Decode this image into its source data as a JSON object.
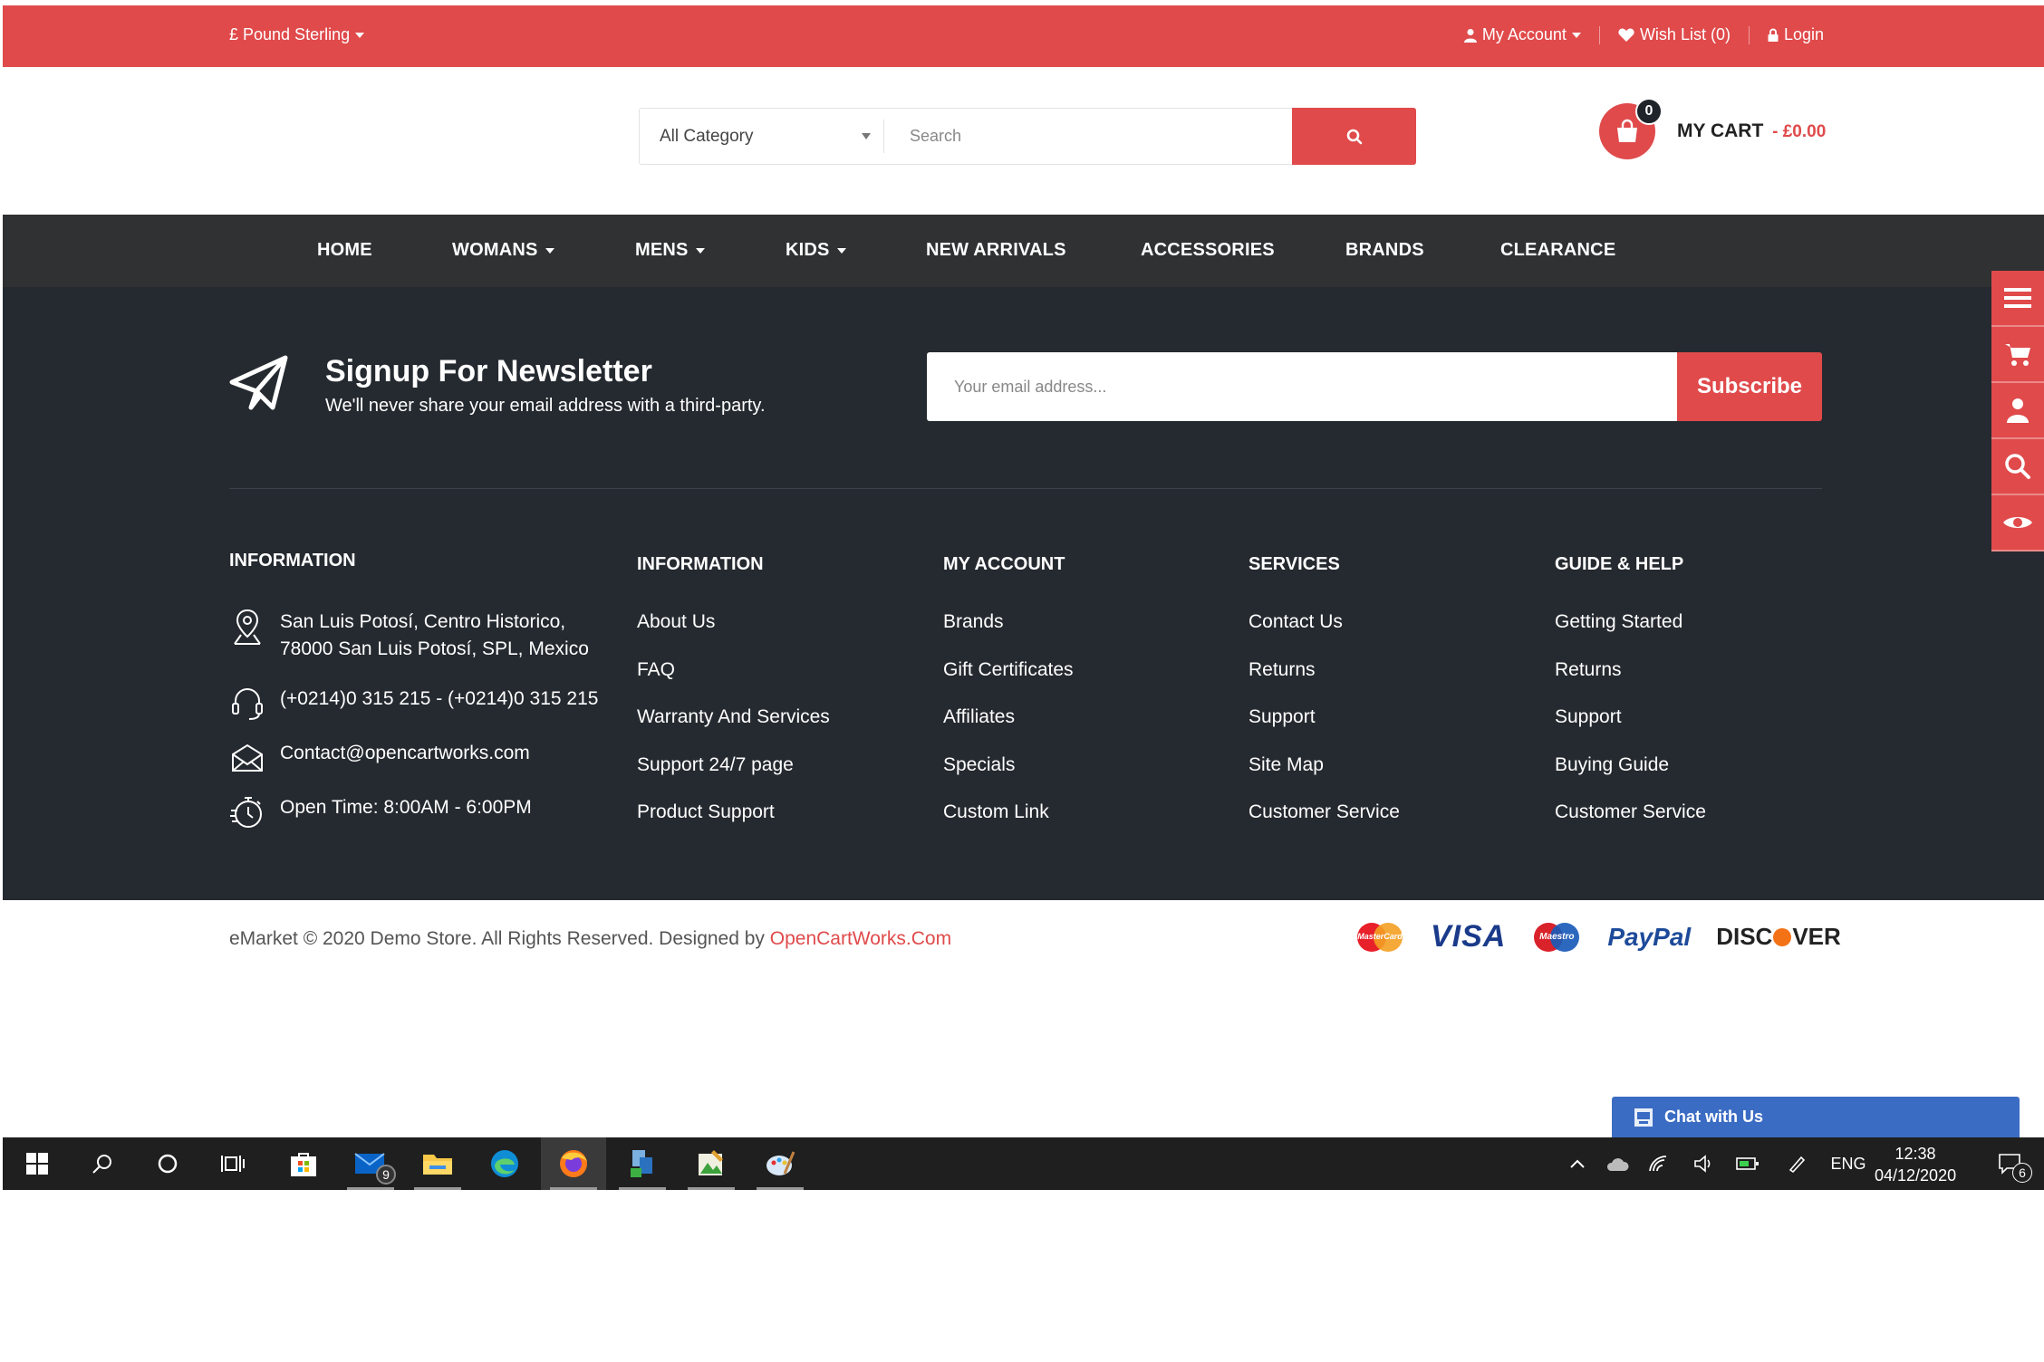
{
  "topbar": {
    "currency": "£ Pound Sterling",
    "my_account": "My Account",
    "wishlist": "Wish List (0)",
    "login": "Login"
  },
  "header": {
    "category_select": "All Category",
    "search_placeholder": "Search",
    "cart_count": "0",
    "cart_label": "MY CART",
    "cart_total": "- £0.00"
  },
  "nav": {
    "home": "HOME",
    "womans": "WOMANS",
    "mens": "MENS",
    "kids": "KIDS",
    "new_arrivals": "NEW ARRIVALS",
    "accessories": "ACCESSORIES",
    "brands": "BRANDS",
    "clearance": "CLEARANCE"
  },
  "newsletter": {
    "title": "Signup For Newsletter",
    "subtitle": "We'll never share your email address with a third-party.",
    "email_placeholder": "Your email address...",
    "subscribe": "Subscribe"
  },
  "footer": {
    "contact_heading": "INFORMATION",
    "address_line1": "San Luis Potosí, Centro Historico,",
    "address_line2": "78000 San Luis Potosí, SPL, Mexico",
    "phone": "(+0214)0 315 215 - (+0214)0 315 215",
    "email": "Contact@opencartworks.com",
    "open_time": "Open Time: 8:00AM - 6:00PM",
    "columns": [
      {
        "heading": "INFORMATION",
        "links": [
          "About Us",
          "FAQ",
          "Warranty And Services",
          "Support 24/7 page",
          "Product Support"
        ]
      },
      {
        "heading": "MY ACCOUNT",
        "links": [
          "Brands",
          "Gift Certificates",
          "Affiliates",
          "Specials",
          "Custom Link"
        ]
      },
      {
        "heading": "SERVICES",
        "links": [
          "Contact Us",
          "Returns",
          "Support",
          "Site Map",
          "Customer Service"
        ]
      },
      {
        "heading": "GUIDE & HELP",
        "links": [
          "Getting Started",
          "Returns",
          "Support",
          "Buying Guide",
          "Customer Service"
        ]
      }
    ]
  },
  "copyright": {
    "text": "eMarket © 2020 Demo Store. All Rights Reserved. Designed by ",
    "link": "OpenCartWorks.Com"
  },
  "payments": {
    "mastercard": "MasterCard",
    "visa": "VISA",
    "maestro": "Maestro",
    "paypal": "PayPal",
    "discover": "DISC",
    "discover_end": "VER"
  },
  "chat": {
    "label": "Chat with Us"
  },
  "taskbar": {
    "mail_badge": "9",
    "language": "ENG",
    "time": "12:38",
    "date": "04/12/2020",
    "notifications": "6"
  },
  "colors": {
    "accent": "#e04a4b",
    "nav_bg": "#2f3132",
    "footer_bg": "#252a30",
    "taskbar_bg": "#1f1f1f",
    "chat_bg": "#3b6cc4"
  }
}
